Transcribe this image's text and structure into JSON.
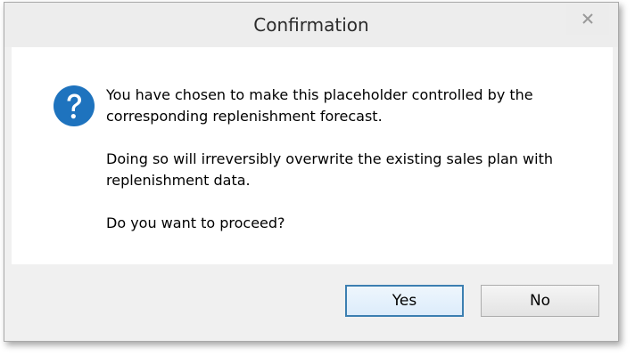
{
  "dialog": {
    "title": "Confirmation",
    "icon": "question-icon",
    "messages": [
      "You have chosen to make this placeholder controlled by the corresponding replenishment forecast.",
      "Doing so will irreversibly overwrite the existing sales plan with replenishment data.",
      "Do you want to proceed?"
    ],
    "buttons": {
      "yes_label": "Yes",
      "no_label": "No"
    },
    "close_icon": "close-icon"
  },
  "colors": {
    "icon_blue": "#1e73be",
    "default_button_border": "#3c7fb1"
  }
}
